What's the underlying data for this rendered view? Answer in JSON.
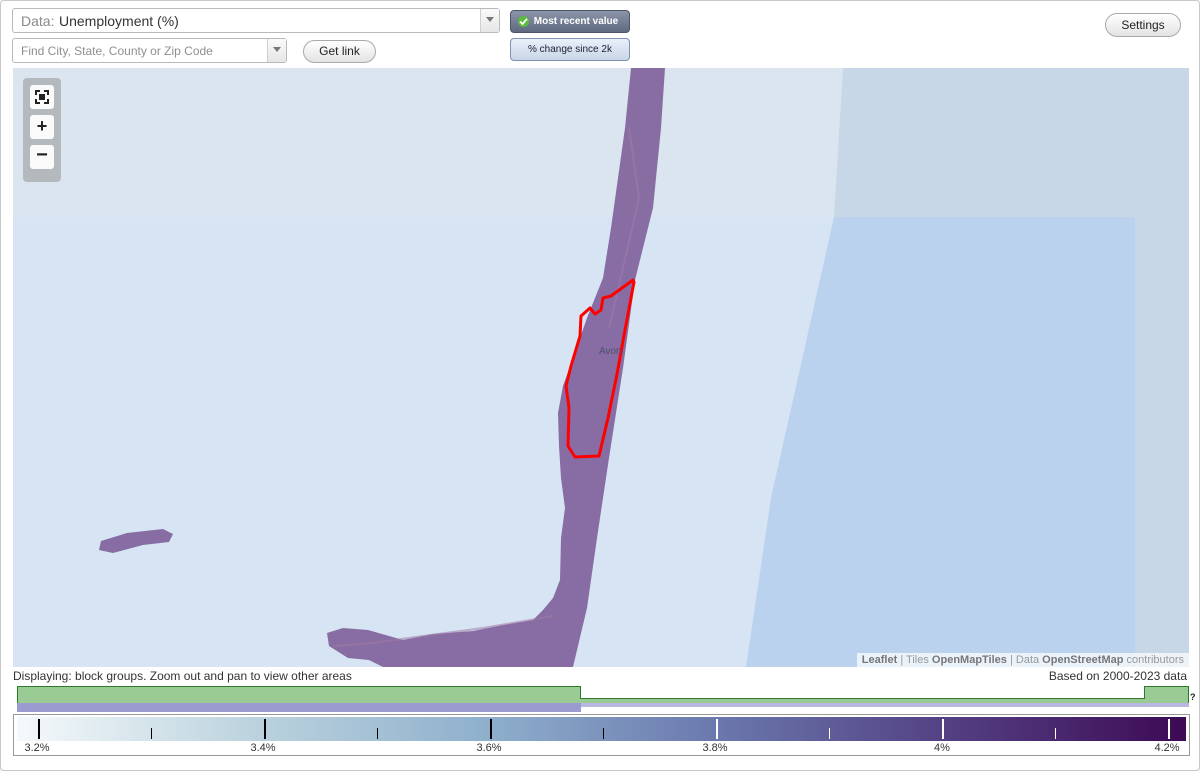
{
  "data_select": {
    "prefix": "Data:",
    "value": "Unemployment (%)"
  },
  "search": {
    "placeholder": "Find City, State, County or Zip Code"
  },
  "buttons": {
    "get_link": "Get link",
    "settings": "Settings"
  },
  "view_toggle": {
    "most_recent": "Most recent value",
    "change_since": "% change since 2k",
    "active": "most_recent"
  },
  "map": {
    "place_label": "Avon",
    "zoom_in": "+",
    "zoom_out": "−",
    "attribution": {
      "leaflet": "Leaflet",
      "sep1": " | Tiles ",
      "tiles": "OpenMapTiles",
      "sep2": " | Data ",
      "data": "OpenStreetMap",
      "suffix": " contributors"
    },
    "highlight_color": "#ff0000",
    "region_color": "#7e5f9a"
  },
  "status": {
    "displaying": "Displaying: block groups. Zoom out and pan to view other areas",
    "based_on": "Based on 2000-2023 data"
  },
  "timeline": {
    "help": "?",
    "fill_color": "#9bcb95",
    "coverage_color": "#9c9bd0"
  },
  "legend": {
    "labels": [
      "3.2%",
      "3.4%",
      "3.6%",
      "3.8%",
      "4%",
      "4.2%"
    ]
  }
}
